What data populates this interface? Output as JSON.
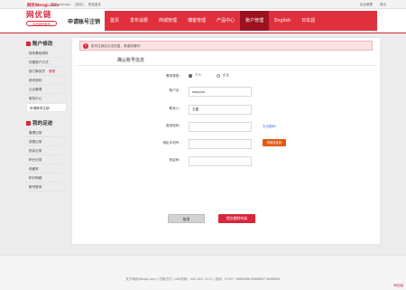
{
  "topbar": {
    "brand": "网优Wengi.com",
    "links": [
      "您好, wengiu",
      "[退出]",
      "短信留言"
    ],
    "right_links": [
      "后台管理",
      "退出"
    ]
  },
  "header": {
    "logo_text": "网优链",
    "logo_sub": "高品网优服务",
    "page_title": "申请账号注销",
    "nav": [
      {
        "label": "首页",
        "active": false
      },
      {
        "label": "发布消费",
        "active": false
      },
      {
        "label": "商城管理",
        "active": false
      },
      {
        "label": "博客管理",
        "active": false
      },
      {
        "label": "产品中心",
        "active": false
      },
      {
        "label": "账户管理",
        "active": true
      },
      {
        "label": "English",
        "active": false
      },
      {
        "label": "日本語",
        "active": false
      }
    ]
  },
  "sidebar": {
    "group1_title": "账户修改",
    "group1_items": [
      {
        "label": "修改基础资料"
      },
      {
        "label": "完善账户方式"
      },
      {
        "label": "部门事务员",
        "tag": "管理"
      },
      {
        "label": "修改密码"
      },
      {
        "label": "认证管理"
      },
      {
        "label": "服务中心"
      },
      {
        "label": "申请账号注销"
      }
    ],
    "group2_title": "我的足迹",
    "group2_items": [
      {
        "label": "管理记录"
      },
      {
        "label": "查看记录"
      },
      {
        "label": "购买记录"
      },
      {
        "label": "积分记录"
      },
      {
        "label": "收藏夹"
      },
      {
        "label": "积分明细"
      },
      {
        "label": "账号登录"
      }
    ]
  },
  "main": {
    "alert_icon": "!",
    "alert_text": "账号注销后无法恢复，请谨慎操作！",
    "form_title": "确认账号信息",
    "account_type_label": "需求类型：",
    "account_type_options": [
      "个人",
      "企业"
    ],
    "account_name_label": "账户名：",
    "account_name_value": "wangliu",
    "contact_label": "联系人：",
    "contact_value": "王磊",
    "password_label": "登录密码：",
    "password_link": "忘记密码?",
    "phone_label": "绑定手机号：",
    "sms_button": "获取验证码",
    "verify_label": "验证码：",
    "cancel_button": "取消",
    "submit_button": "提交删除申请"
  },
  "footer": {
    "text": "关于网优Wengi.com  |  付款方式  |  400热线：400 622 1112  |  热线：0799－6666666  6666667  6666664",
    "corner": "网优链"
  },
  "colors": {
    "brand_red": "#d7263d",
    "nav_active": "#9c1220",
    "sms_orange": "#e15b12"
  }
}
